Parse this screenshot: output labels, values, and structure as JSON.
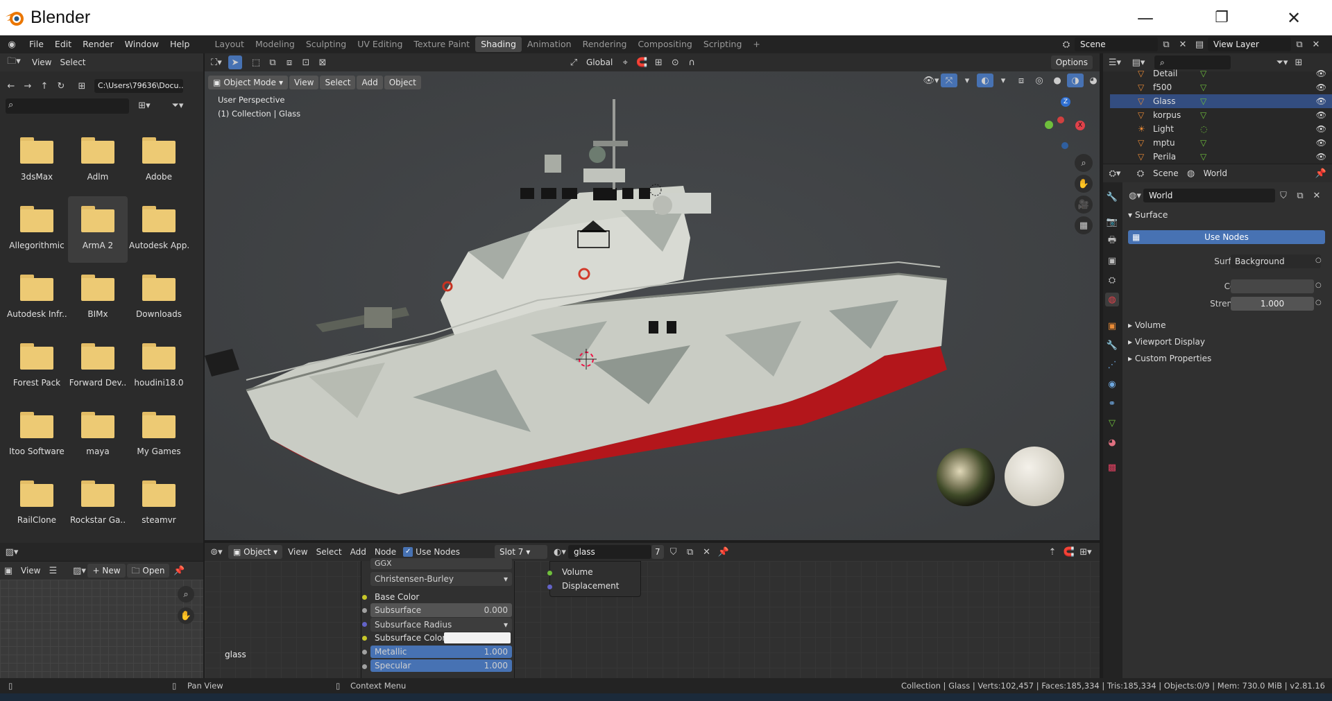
{
  "app_title": "Blender",
  "window": {
    "minimize": "—",
    "maximize": "❐",
    "close": "✕"
  },
  "menu": [
    "File",
    "Edit",
    "Render",
    "Window",
    "Help"
  ],
  "workspaces": [
    "Layout",
    "Modeling",
    "Sculpting",
    "UV Editing",
    "Texture Paint",
    "Shading",
    "Animation",
    "Rendering",
    "Compositing",
    "Scripting"
  ],
  "active_workspace": "Shading",
  "scene": {
    "label": "Scene",
    "view_layer": "View Layer"
  },
  "file_browser": {
    "header": [
      "View",
      "Select"
    ],
    "path": "C:\\Users\\79636\\Docu...",
    "folders": [
      "3dsMax",
      "Adlm",
      "Adobe",
      "Allegorithmic",
      "ArmA 2",
      "Autodesk App..",
      "Autodesk Infr..",
      "BIMx",
      "Downloads",
      "Forest Pack",
      "Forward Dev..",
      "houdini18.0",
      "Itoo Software",
      "maya",
      "My Games",
      "RailClone",
      "Rockstar Ga..",
      "steamvr"
    ],
    "selected": "ArmA 2"
  },
  "image_editor": {
    "view": "View",
    "new": "New",
    "open": "Open"
  },
  "viewport": {
    "mode": "Object Mode",
    "header": [
      "View",
      "Select",
      "Add",
      "Object"
    ],
    "transform": "Global",
    "options": "Options",
    "overlay_line1": "User Perspective",
    "overlay_line2": "(1) Collection | Glass",
    "gizmo": {
      "x": "X",
      "y": "Y",
      "z": "Z"
    }
  },
  "outliner": {
    "items": [
      {
        "name": "Detail",
        "icon": "mesh"
      },
      {
        "name": "f500",
        "icon": "mesh"
      },
      {
        "name": "Glass",
        "icon": "mesh"
      },
      {
        "name": "korpus",
        "icon": "mesh"
      },
      {
        "name": "Light",
        "icon": "light"
      },
      {
        "name": "mptu",
        "icon": "mesh"
      },
      {
        "name": "Perila",
        "icon": "mesh"
      }
    ]
  },
  "properties": {
    "breadcrumb_scene": "Scene",
    "breadcrumb_world": "World",
    "world_name": "World",
    "surface_section": "Surface",
    "use_nodes": "Use Nodes",
    "surface_label": "Surface",
    "surface_value": "Background",
    "color_label": "Color",
    "strength_label": "Strength",
    "strength_value": "1.000",
    "sections": [
      "Volume",
      "Viewport Display",
      "Custom Properties"
    ]
  },
  "node_editor": {
    "header": {
      "object": "Object",
      "menus": [
        "View",
        "Select",
        "Add",
        "Node"
      ],
      "use_nodes": "Use Nodes",
      "slot": "Slot 7",
      "material": "glass",
      "users": "7"
    },
    "material_label": "glass",
    "dist": "GGX",
    "sss_method": "Christensen-Burley",
    "base_color": "Base Color",
    "subsurface": {
      "label": "Subsurface",
      "value": "0.000"
    },
    "subsurface_radius": "Subsurface Radius",
    "subsurface_color": "Subsurface Color",
    "metallic": {
      "label": "Metallic",
      "value": "1.000"
    },
    "specular": {
      "label": "Specular",
      "value": "1.000"
    },
    "output_sockets": [
      "Volume",
      "Displacement"
    ]
  },
  "statusbar": {
    "left": "Pan View",
    "mid": "Context Menu",
    "right": "Collection | Glass | Verts:102,457 | Faces:185,334 | Tris:185,334 | Objects:0/9 | Mem: 730.0 MiB | v2.81.16"
  },
  "colors": {
    "accent": "#4772b3",
    "hull_red": "#b3161b",
    "folder": "#edca74",
    "bg": "#3d3d3d"
  }
}
